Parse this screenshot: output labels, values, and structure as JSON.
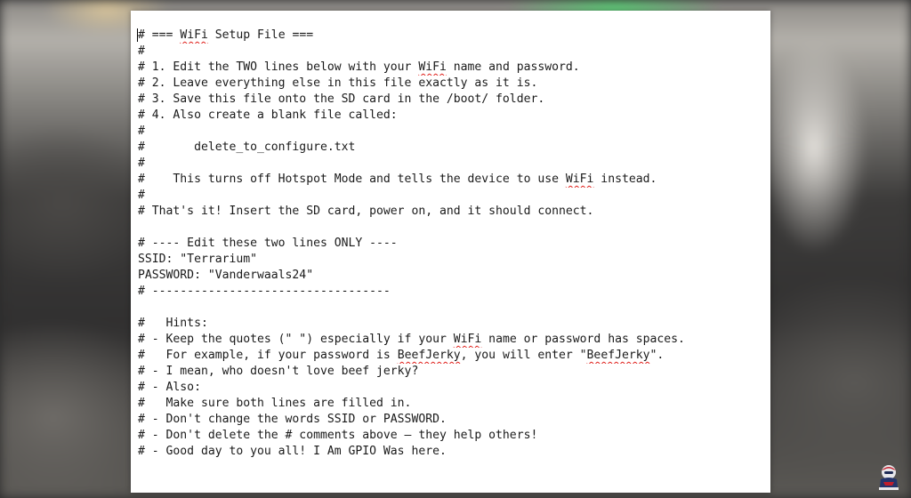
{
  "document": {
    "lines": [
      {
        "segments": [
          {
            "t": "# === "
          },
          {
            "t": "WiFi",
            "s": true
          },
          {
            "t": " Setup File ==="
          }
        ]
      },
      {
        "segments": [
          {
            "t": "#"
          }
        ]
      },
      {
        "segments": [
          {
            "t": "# 1. Edit the TWO lines below with your "
          },
          {
            "t": "WiFi",
            "s": true
          },
          {
            "t": " name and password."
          }
        ]
      },
      {
        "segments": [
          {
            "t": "# 2. Leave everything else in this file exactly as it is."
          }
        ]
      },
      {
        "segments": [
          {
            "t": "# 3. Save this file onto the SD card in the /boot/ folder."
          }
        ]
      },
      {
        "segments": [
          {
            "t": "# 4. Also create a blank file called:"
          }
        ]
      },
      {
        "segments": [
          {
            "t": "#"
          }
        ]
      },
      {
        "segments": [
          {
            "t": "#       delete_to_configure.txt"
          }
        ]
      },
      {
        "segments": [
          {
            "t": "#"
          }
        ]
      },
      {
        "segments": [
          {
            "t": "#    This turns off Hotspot Mode and tells the device to use "
          },
          {
            "t": "WiFi",
            "s": true
          },
          {
            "t": " instead."
          }
        ]
      },
      {
        "segments": [
          {
            "t": "#"
          }
        ]
      },
      {
        "segments": [
          {
            "t": "# That's it! Insert the SD card, power on, and it should connect."
          }
        ]
      },
      {
        "segments": [
          {
            "t": ""
          }
        ]
      },
      {
        "segments": [
          {
            "t": "# ---- Edit these two lines ONLY ----"
          }
        ]
      },
      {
        "segments": [
          {
            "t": "SSID: \"Terrarium\""
          }
        ]
      },
      {
        "segments": [
          {
            "t": "PASSWORD: \"Vanderwaals24\""
          }
        ]
      },
      {
        "segments": [
          {
            "t": "# ----------------------------------"
          }
        ]
      },
      {
        "segments": [
          {
            "t": ""
          }
        ]
      },
      {
        "segments": [
          {
            "t": "#   Hints:"
          }
        ]
      },
      {
        "segments": [
          {
            "t": "# - Keep the quotes (\" \") especially if your "
          },
          {
            "t": "WiFi",
            "s": true
          },
          {
            "t": " name or password has spaces."
          }
        ]
      },
      {
        "segments": [
          {
            "t": "#   For example, if your password is "
          },
          {
            "t": "BeefJerky",
            "s": true
          },
          {
            "t": ", you will enter \""
          },
          {
            "t": "BeefJerky",
            "s": true
          },
          {
            "t": "\"."
          }
        ]
      },
      {
        "segments": [
          {
            "t": "# - I mean, who doesn't love beef jerky?"
          }
        ]
      },
      {
        "segments": [
          {
            "t": "# - Also:"
          }
        ]
      },
      {
        "segments": [
          {
            "t": "#   Make sure both lines are filled in."
          }
        ]
      },
      {
        "segments": [
          {
            "t": "# - Don't change the words SSID or PASSWORD."
          }
        ]
      },
      {
        "segments": [
          {
            "t": "# - Don't delete the # comments above – they help others!"
          }
        ]
      },
      {
        "segments": [
          {
            "t": "# - Good day to you all! I Am GPIO Was here."
          }
        ]
      }
    ]
  },
  "colors": {
    "page": "#ffffff",
    "text": "#1a1a1a",
    "spellcheck_underline": "#e0201b"
  },
  "icons": {
    "channel_logo": "channel-logo-icon"
  }
}
